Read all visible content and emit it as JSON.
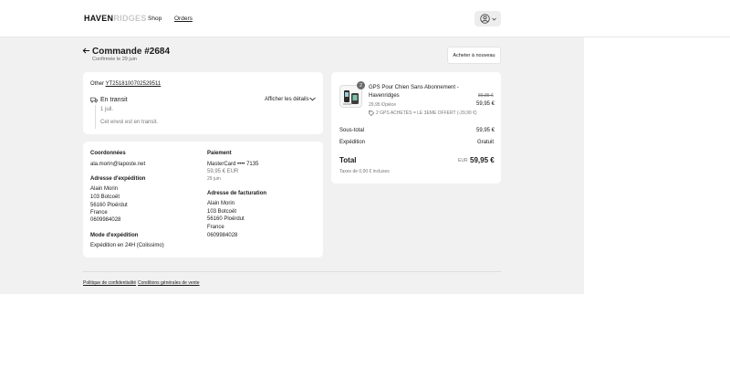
{
  "header": {
    "logo_dark": "HAVEN",
    "logo_light": "RIDGES",
    "nav": [
      "Shop",
      "Orders"
    ]
  },
  "order": {
    "title": "Commande #2684",
    "subtitle": "Confirmée le 29 juin",
    "buy_again": "Acheter à nouveau"
  },
  "shipping": {
    "carrier_label": "Other",
    "tracking": "YT2518100702529511",
    "status": "En transit",
    "details_link": "Afficher les détails",
    "date": "1 juil.",
    "message": "Cet envoi est en transit."
  },
  "info": {
    "contact_heading": "Coordonnées",
    "email": "ala.morin@laposte.net",
    "ship_addr_heading": "Adresse d'expédition",
    "ship_addr": [
      "Alain Morin",
      "103 Botcoët",
      "56160 Ploërdut",
      "France",
      "0609984028"
    ],
    "ship_mode_heading": "Mode d'expédition",
    "ship_mode": "Expédition en 24H (Colissimo)",
    "payment_heading": "Paiement",
    "card": "MasterCard •••• 7135",
    "amount": "59,95 € EUR",
    "pay_date": "29 juin",
    "bill_addr_heading": "Adresse de facturation",
    "bill_addr": [
      "Alain Morin",
      "103 Botcoët",
      "56160 Ploërdut",
      "France",
      "0609984028"
    ]
  },
  "summary": {
    "quantity": "2",
    "product_name_line1": "GPS Pour Chien Sans Abonnement -",
    "product_name_line2": "Havenridges",
    "unit_price": "29,95 €/pièce",
    "discount": "2 GPS ACHETÉS = LE 3EME OFFERT (-29,90 €)",
    "old_price": "89,85 €",
    "price": "59,95 €",
    "subtotal_label": "Sous-total",
    "subtotal": "59,95 €",
    "shipping_label": "Expédition",
    "shipping_value": "Gratuit",
    "total_label": "Total",
    "currency": "EUR",
    "total": "59,95 €",
    "taxes": "Taxes de 0,00 € incluses"
  },
  "footer": {
    "privacy": "Politique de confidentialité",
    "terms": "Conditions générales de vente"
  }
}
